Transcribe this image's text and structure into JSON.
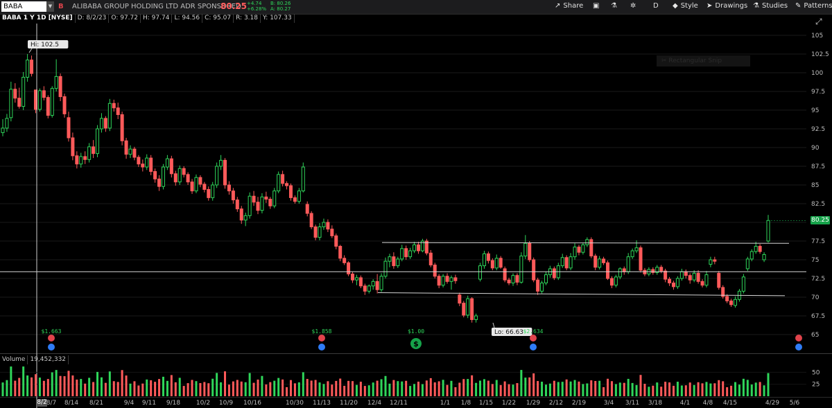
{
  "header": {
    "symbol": "BABA",
    "badge": "B",
    "company": "ALIBABA GROUP HOLDING LTD ADR SPONSORED",
    "last": "80.25",
    "change": "+4.74",
    "change_pct": "+6.28%",
    "bid": "B: 80.26",
    "ask": "A: 80.27",
    "share_label": "Share",
    "period_label": "D",
    "style_label": "Style",
    "drawings_label": "Drawings",
    "studies_label": "Studies",
    "patterns_label": "Patterns"
  },
  "info": {
    "title": "BABA 1 Y 1D [NYSE]",
    "date": "D: 8/2/23",
    "open": "O: 97.72",
    "high": "H: 97.74",
    "low": "L: 94.56",
    "close": "C: 95.07",
    "range": "R: 3.18",
    "y": "Y: 107.33"
  },
  "overlay": {
    "rect_snap": "Rectangular Snip",
    "hi_label": "Hi: 102.5",
    "lo_label": "Lo: 66.63",
    "price_tag": "80.25"
  },
  "volume": {
    "label": "Volume",
    "value": "19,452,332"
  },
  "colors": {
    "up": "#2fd65a",
    "down": "#ff5a5a",
    "grid": "#1a1a1a",
    "line": "#d8d8d8"
  },
  "chart_data": {
    "type": "candlestick",
    "y_ticks": [
      "105",
      "102.5",
      "100",
      "97.5",
      "95",
      "92.5",
      "90",
      "87.5",
      "85",
      "82.5",
      "80",
      "77.5",
      "75",
      "72.5",
      "70",
      "67.5",
      "65"
    ],
    "ylim": [
      63.2,
      107.33
    ],
    "x_ticks": [
      "8/2",
      "8/7",
      "8/14",
      "8/21",
      "9/4",
      "9/11",
      "9/18",
      "10/2",
      "10/9",
      "10/16",
      "10/30",
      "11/13",
      "11/20",
      "12/4",
      "12/11",
      "1/1",
      "1/8",
      "1/15",
      "1/22",
      "1/29",
      "2/12",
      "2/19",
      "3/4",
      "3/11",
      "3/18",
      "4/1",
      "4/8",
      "4/15",
      "4/29",
      "5/6"
    ],
    "volume_ticks": [
      "50",
      "25"
    ],
    "events": [
      {
        "label": "$1.663",
        "x_date": "8/7"
      },
      {
        "label": "$1.858",
        "x_date": "11/13"
      },
      {
        "label": "$1.00",
        "x_date": "12/18"
      },
      {
        "label": "$2.634",
        "x_date": "1/29"
      }
    ],
    "lines": [
      {
        "name": "horizontal",
        "y": 73.4
      },
      {
        "name": "channel-top",
        "y1": 77.3,
        "y2": 77.2
      },
      {
        "name": "channel-bottom",
        "y1": 70.6,
        "y2": 70.2
      }
    ],
    "series": [
      {
        "o": 92.0,
        "h": 93.8,
        "l": 91.5,
        "c": 92.6
      },
      {
        "o": 92.6,
        "h": 94.5,
        "l": 92.1,
        "c": 93.9
      },
      {
        "o": 94.0,
        "h": 98.8,
        "l": 93.5,
        "c": 97.8
      },
      {
        "o": 97.8,
        "h": 98.6,
        "l": 96.0,
        "c": 96.6
      },
      {
        "o": 96.6,
        "h": 98.0,
        "l": 95.2,
        "c": 95.5
      },
      {
        "o": 95.5,
        "h": 100.1,
        "l": 95.0,
        "c": 99.4
      },
      {
        "o": 99.4,
        "h": 102.5,
        "l": 98.8,
        "c": 101.7
      },
      {
        "o": 101.7,
        "h": 102.3,
        "l": 99.5,
        "c": 99.9
      },
      {
        "o": 97.7,
        "h": 97.7,
        "l": 94.6,
        "c": 95.1
      },
      {
        "o": 95.1,
        "h": 97.9,
        "l": 94.8,
        "c": 97.6
      },
      {
        "o": 97.6,
        "h": 98.2,
        "l": 96.3,
        "c": 96.7
      },
      {
        "o": 96.7,
        "h": 97.0,
        "l": 93.9,
        "c": 94.3
      },
      {
        "o": 94.3,
        "h": 98.2,
        "l": 94.0,
        "c": 97.9
      },
      {
        "o": 97.9,
        "h": 101.8,
        "l": 97.5,
        "c": 99.5
      },
      {
        "o": 99.5,
        "h": 99.9,
        "l": 96.2,
        "c": 96.8
      },
      {
        "o": 96.8,
        "h": 97.2,
        "l": 94.0,
        "c": 94.5
      },
      {
        "o": 94.0,
        "h": 94.8,
        "l": 90.8,
        "c": 91.3
      },
      {
        "o": 91.3,
        "h": 92.0,
        "l": 88.3,
        "c": 88.9
      },
      {
        "o": 88.9,
        "h": 89.5,
        "l": 87.2,
        "c": 87.8
      },
      {
        "o": 87.8,
        "h": 89.3,
        "l": 87.3,
        "c": 88.8
      },
      {
        "o": 88.8,
        "h": 89.5,
        "l": 87.8,
        "c": 88.4
      },
      {
        "o": 88.4,
        "h": 90.6,
        "l": 88.0,
        "c": 90.1
      },
      {
        "o": 90.1,
        "h": 91.0,
        "l": 88.6,
        "c": 89.2
      },
      {
        "o": 89.2,
        "h": 93.0,
        "l": 88.7,
        "c": 92.5
      },
      {
        "o": 92.5,
        "h": 94.6,
        "l": 92.0,
        "c": 93.9
      },
      {
        "o": 93.9,
        "h": 94.2,
        "l": 92.1,
        "c": 92.6
      },
      {
        "o": 92.6,
        "h": 96.5,
        "l": 92.2,
        "c": 95.9
      },
      {
        "o": 95.9,
        "h": 96.4,
        "l": 94.8,
        "c": 95.3
      },
      {
        "o": 95.3,
        "h": 96.0,
        "l": 93.8,
        "c": 94.4
      },
      {
        "o": 94.4,
        "h": 94.8,
        "l": 90.3,
        "c": 90.9
      },
      {
        "o": 90.9,
        "h": 91.3,
        "l": 88.5,
        "c": 89.1
      },
      {
        "o": 89.1,
        "h": 90.3,
        "l": 88.6,
        "c": 89.8
      },
      {
        "o": 89.8,
        "h": 90.1,
        "l": 88.3,
        "c": 88.7
      },
      {
        "o": 88.7,
        "h": 89.0,
        "l": 87.4,
        "c": 87.8
      },
      {
        "o": 87.8,
        "h": 88.4,
        "l": 86.8,
        "c": 87.4
      },
      {
        "o": 87.4,
        "h": 89.1,
        "l": 87.0,
        "c": 88.6
      },
      {
        "o": 88.6,
        "h": 89.0,
        "l": 86.3,
        "c": 86.8
      },
      {
        "o": 86.8,
        "h": 87.2,
        "l": 85.3,
        "c": 85.8
      },
      {
        "o": 85.8,
        "h": 86.3,
        "l": 84.2,
        "c": 84.8
      },
      {
        "o": 84.8,
        "h": 87.8,
        "l": 84.4,
        "c": 87.4
      },
      {
        "o": 87.4,
        "h": 89.0,
        "l": 87.0,
        "c": 88.5
      },
      {
        "o": 88.5,
        "h": 88.9,
        "l": 86.0,
        "c": 86.5
      },
      {
        "o": 86.5,
        "h": 86.9,
        "l": 84.9,
        "c": 85.4
      },
      {
        "o": 85.4,
        "h": 87.6,
        "l": 85.0,
        "c": 87.2
      },
      {
        "o": 87.2,
        "h": 87.5,
        "l": 86.0,
        "c": 86.4
      },
      {
        "o": 86.4,
        "h": 86.7,
        "l": 85.0,
        "c": 85.4
      },
      {
        "o": 85.4,
        "h": 85.8,
        "l": 83.8,
        "c": 84.2
      },
      {
        "o": 84.2,
        "h": 86.4,
        "l": 83.9,
        "c": 86.0
      },
      {
        "o": 86.0,
        "h": 86.3,
        "l": 84.7,
        "c": 85.1
      },
      {
        "o": 85.1,
        "h": 85.4,
        "l": 84.0,
        "c": 84.4
      },
      {
        "o": 84.4,
        "h": 84.8,
        "l": 82.9,
        "c": 83.3
      },
      {
        "o": 83.3,
        "h": 85.4,
        "l": 82.9,
        "c": 85.0
      },
      {
        "o": 85.0,
        "h": 88.0,
        "l": 84.6,
        "c": 87.5
      },
      {
        "o": 87.5,
        "h": 89.0,
        "l": 87.0,
        "c": 88.3
      },
      {
        "o": 88.3,
        "h": 88.6,
        "l": 84.5,
        "c": 85.0
      },
      {
        "o": 85.0,
        "h": 85.5,
        "l": 83.7,
        "c": 84.2
      },
      {
        "o": 84.2,
        "h": 84.6,
        "l": 82.5,
        "c": 83.0
      },
      {
        "o": 83.0,
        "h": 83.4,
        "l": 81.4,
        "c": 81.8
      },
      {
        "o": 81.8,
        "h": 82.2,
        "l": 79.8,
        "c": 80.3
      },
      {
        "o": 80.3,
        "h": 81.3,
        "l": 79.5,
        "c": 80.9
      },
      {
        "o": 80.9,
        "h": 84.0,
        "l": 80.5,
        "c": 83.5
      },
      {
        "o": 83.5,
        "h": 84.2,
        "l": 82.2,
        "c": 82.7
      },
      {
        "o": 82.7,
        "h": 83.4,
        "l": 81.1,
        "c": 81.6
      },
      {
        "o": 81.6,
        "h": 83.9,
        "l": 81.2,
        "c": 83.4
      },
      {
        "o": 83.4,
        "h": 84.1,
        "l": 82.6,
        "c": 83.1
      },
      {
        "o": 83.1,
        "h": 83.4,
        "l": 81.8,
        "c": 82.2
      },
      {
        "o": 82.2,
        "h": 84.6,
        "l": 81.9,
        "c": 84.2
      },
      {
        "o": 84.2,
        "h": 86.8,
        "l": 83.9,
        "c": 86.4
      },
      {
        "o": 86.4,
        "h": 86.9,
        "l": 84.8,
        "c": 85.2
      },
      {
        "o": 85.2,
        "h": 85.5,
        "l": 84.4,
        "c": 84.9
      },
      {
        "o": 84.9,
        "h": 85.2,
        "l": 82.9,
        "c": 83.3
      },
      {
        "o": 83.3,
        "h": 83.6,
        "l": 82.5,
        "c": 82.8
      },
      {
        "o": 82.8,
        "h": 84.6,
        "l": 82.5,
        "c": 84.2
      },
      {
        "o": 84.2,
        "h": 88.0,
        "l": 84.0,
        "c": 87.4
      },
      {
        "o": 82.4,
        "h": 82.8,
        "l": 80.8,
        "c": 81.2
      },
      {
        "o": 81.2,
        "h": 81.5,
        "l": 79.1,
        "c": 79.4
      },
      {
        "o": 79.4,
        "h": 79.7,
        "l": 77.6,
        "c": 78.0
      },
      {
        "o": 78.0,
        "h": 79.9,
        "l": 77.6,
        "c": 79.4
      },
      {
        "o": 79.4,
        "h": 80.5,
        "l": 79.0,
        "c": 80.0
      },
      {
        "o": 80.0,
        "h": 80.4,
        "l": 78.7,
        "c": 79.1
      },
      {
        "o": 79.1,
        "h": 79.6,
        "l": 77.9,
        "c": 78.2
      },
      {
        "o": 78.2,
        "h": 78.5,
        "l": 76.4,
        "c": 76.8
      },
      {
        "o": 76.8,
        "h": 77.0,
        "l": 74.8,
        "c": 75.2
      },
      {
        "o": 75.2,
        "h": 75.6,
        "l": 74.3,
        "c": 74.6
      },
      {
        "o": 74.6,
        "h": 74.8,
        "l": 72.8,
        "c": 73.1
      },
      {
        "o": 73.1,
        "h": 73.4,
        "l": 71.9,
        "c": 72.3
      },
      {
        "o": 72.3,
        "h": 73.0,
        "l": 71.6,
        "c": 72.6
      },
      {
        "o": 72.6,
        "h": 72.9,
        "l": 71.2,
        "c": 71.5
      },
      {
        "o": 71.5,
        "h": 71.8,
        "l": 70.3,
        "c": 70.8
      },
      {
        "o": 70.8,
        "h": 71.7,
        "l": 70.5,
        "c": 71.5
      },
      {
        "o": 71.5,
        "h": 72.4,
        "l": 71.0,
        "c": 72.1
      },
      {
        "o": 72.1,
        "h": 73.1,
        "l": 70.5,
        "c": 71.0
      },
      {
        "o": 71.0,
        "h": 73.2,
        "l": 70.7,
        "c": 72.8
      },
      {
        "o": 72.8,
        "h": 75.3,
        "l": 72.5,
        "c": 74.8
      },
      {
        "o": 74.8,
        "h": 75.8,
        "l": 74.0,
        "c": 75.4
      },
      {
        "o": 75.4,
        "h": 76.0,
        "l": 73.8,
        "c": 74.2
      },
      {
        "o": 74.2,
        "h": 75.4,
        "l": 73.9,
        "c": 75.1
      },
      {
        "o": 75.1,
        "h": 77.0,
        "l": 74.8,
        "c": 76.5
      },
      {
        "o": 76.5,
        "h": 76.9,
        "l": 75.0,
        "c": 75.4
      },
      {
        "o": 75.4,
        "h": 76.6,
        "l": 75.1,
        "c": 76.2
      },
      {
        "o": 76.2,
        "h": 77.4,
        "l": 75.9,
        "c": 77.0
      },
      {
        "o": 77.0,
        "h": 77.4,
        "l": 75.8,
        "c": 76.2
      },
      {
        "o": 76.2,
        "h": 77.8,
        "l": 76.0,
        "c": 77.5
      },
      {
        "o": 77.5,
        "h": 77.8,
        "l": 75.6,
        "c": 75.9
      },
      {
        "o": 75.9,
        "h": 76.3,
        "l": 74.0,
        "c": 74.3
      },
      {
        "o": 74.3,
        "h": 74.6,
        "l": 72.5,
        "c": 72.8
      },
      {
        "o": 72.8,
        "h": 73.1,
        "l": 71.2,
        "c": 71.6
      },
      {
        "o": 71.6,
        "h": 73.1,
        "l": 71.3,
        "c": 72.8
      },
      {
        "o": 72.8,
        "h": 73.2,
        "l": 71.8,
        "c": 72.1
      },
      {
        "o": 72.1,
        "h": 72.9,
        "l": 71.0,
        "c": 72.6
      },
      {
        "o": 72.6,
        "h": 73.0,
        "l": 71.8,
        "c": 72.2
      },
      {
        "o": 70.3,
        "h": 70.6,
        "l": 68.8,
        "c": 69.2
      },
      {
        "o": 69.2,
        "h": 69.5,
        "l": 67.3,
        "c": 67.6
      },
      {
        "o": 67.6,
        "h": 70.2,
        "l": 67.2,
        "c": 69.8
      },
      {
        "o": 69.8,
        "h": 70.0,
        "l": 66.6,
        "c": 67.0
      },
      {
        "o": 67.0,
        "h": 67.8,
        "l": 66.6,
        "c": 67.5
      },
      {
        "o": 72.4,
        "h": 74.6,
        "l": 72.1,
        "c": 74.2
      },
      {
        "o": 74.2,
        "h": 76.2,
        "l": 73.8,
        "c": 75.8
      },
      {
        "o": 75.8,
        "h": 76.1,
        "l": 74.5,
        "c": 74.9
      },
      {
        "o": 74.9,
        "h": 75.2,
        "l": 73.6,
        "c": 73.9
      },
      {
        "o": 73.9,
        "h": 75.7,
        "l": 73.6,
        "c": 75.2
      },
      {
        "o": 75.2,
        "h": 75.5,
        "l": 73.8,
        "c": 74.0
      },
      {
        "o": 73.8,
        "h": 74.1,
        "l": 72.0,
        "c": 72.3
      },
      {
        "o": 72.3,
        "h": 72.6,
        "l": 71.6,
        "c": 71.9
      },
      {
        "o": 71.9,
        "h": 73.2,
        "l": 71.5,
        "c": 72.9
      },
      {
        "o": 72.9,
        "h": 73.2,
        "l": 71.6,
        "c": 72.0
      },
      {
        "o": 72.0,
        "h": 76.0,
        "l": 71.8,
        "c": 75.5
      },
      {
        "o": 75.5,
        "h": 78.3,
        "l": 75.1,
        "c": 77.2
      },
      {
        "o": 77.2,
        "h": 77.5,
        "l": 74.7,
        "c": 75.0
      },
      {
        "o": 75.0,
        "h": 75.3,
        "l": 72.0,
        "c": 72.3
      },
      {
        "o": 72.3,
        "h": 72.6,
        "l": 70.3,
        "c": 70.8
      },
      {
        "o": 70.8,
        "h": 72.2,
        "l": 70.5,
        "c": 71.9
      },
      {
        "o": 71.9,
        "h": 73.4,
        "l": 71.6,
        "c": 73.0
      },
      {
        "o": 73.0,
        "h": 74.2,
        "l": 72.6,
        "c": 73.8
      },
      {
        "o": 73.8,
        "h": 74.1,
        "l": 72.3,
        "c": 72.6
      },
      {
        "o": 72.6,
        "h": 74.6,
        "l": 72.3,
        "c": 74.2
      },
      {
        "o": 74.2,
        "h": 75.8,
        "l": 73.9,
        "c": 75.3
      },
      {
        "o": 75.3,
        "h": 75.6,
        "l": 73.6,
        "c": 73.9
      },
      {
        "o": 73.9,
        "h": 75.9,
        "l": 73.6,
        "c": 75.4
      },
      {
        "o": 75.4,
        "h": 77.2,
        "l": 75.0,
        "c": 76.7
      },
      {
        "o": 76.7,
        "h": 77.0,
        "l": 75.6,
        "c": 76.0
      },
      {
        "o": 76.0,
        "h": 77.3,
        "l": 75.7,
        "c": 77.0
      },
      {
        "o": 77.0,
        "h": 78.0,
        "l": 76.7,
        "c": 77.7
      },
      {
        "o": 77.7,
        "h": 78.0,
        "l": 75.2,
        "c": 75.5
      },
      {
        "o": 75.5,
        "h": 75.8,
        "l": 73.6,
        "c": 74.0
      },
      {
        "o": 74.0,
        "h": 75.5,
        "l": 73.7,
        "c": 75.1
      },
      {
        "o": 75.1,
        "h": 75.4,
        "l": 74.3,
        "c": 74.6
      },
      {
        "o": 74.6,
        "h": 74.9,
        "l": 72.3,
        "c": 72.5
      },
      {
        "o": 72.5,
        "h": 72.8,
        "l": 71.2,
        "c": 71.6
      },
      {
        "o": 71.6,
        "h": 73.0,
        "l": 71.3,
        "c": 72.7
      },
      {
        "o": 72.7,
        "h": 74.0,
        "l": 72.4,
        "c": 73.8
      },
      {
        "o": 73.8,
        "h": 74.1,
        "l": 73.0,
        "c": 73.4
      },
      {
        "o": 73.4,
        "h": 75.9,
        "l": 73.1,
        "c": 75.4
      },
      {
        "o": 75.4,
        "h": 76.5,
        "l": 75.1,
        "c": 76.2
      },
      {
        "o": 76.2,
        "h": 77.6,
        "l": 75.9,
        "c": 76.6
      },
      {
        "o": 76.6,
        "h": 76.9,
        "l": 73.3,
        "c": 73.6
      },
      {
        "o": 73.6,
        "h": 73.9,
        "l": 72.8,
        "c": 73.1
      },
      {
        "o": 73.1,
        "h": 74.0,
        "l": 72.8,
        "c": 73.7
      },
      {
        "o": 73.7,
        "h": 74.0,
        "l": 73.0,
        "c": 73.3
      },
      {
        "o": 73.3,
        "h": 74.3,
        "l": 73.0,
        "c": 74.0
      },
      {
        "o": 74.0,
        "h": 74.3,
        "l": 73.2,
        "c": 73.5
      },
      {
        "o": 73.5,
        "h": 73.8,
        "l": 72.0,
        "c": 72.4
      },
      {
        "o": 72.4,
        "h": 72.7,
        "l": 71.5,
        "c": 71.9
      },
      {
        "o": 71.9,
        "h": 72.2,
        "l": 71.0,
        "c": 71.4
      },
      {
        "o": 71.4,
        "h": 72.8,
        "l": 71.1,
        "c": 72.5
      },
      {
        "o": 72.5,
        "h": 73.8,
        "l": 72.2,
        "c": 73.4
      },
      {
        "o": 73.4,
        "h": 73.7,
        "l": 72.5,
        "c": 72.9
      },
      {
        "o": 72.9,
        "h": 73.2,
        "l": 71.8,
        "c": 72.3
      },
      {
        "o": 72.3,
        "h": 73.6,
        "l": 72.0,
        "c": 73.2
      },
      {
        "o": 73.2,
        "h": 73.6,
        "l": 71.8,
        "c": 72.1
      },
      {
        "o": 72.1,
        "h": 72.4,
        "l": 71.3,
        "c": 71.6
      },
      {
        "o": 71.6,
        "h": 73.5,
        "l": 71.3,
        "c": 73.0
      },
      {
        "o": 74.4,
        "h": 75.4,
        "l": 74.0,
        "c": 75.0
      },
      {
        "o": 75.0,
        "h": 75.4,
        "l": 74.4,
        "c": 74.8
      },
      {
        "o": 73.2,
        "h": 73.5,
        "l": 71.0,
        "c": 71.3
      },
      {
        "o": 71.3,
        "h": 71.6,
        "l": 69.8,
        "c": 70.1
      },
      {
        "o": 70.1,
        "h": 70.4,
        "l": 69.2,
        "c": 69.5
      },
      {
        "o": 69.5,
        "h": 69.8,
        "l": 68.7,
        "c": 69.0
      },
      {
        "o": 68.9,
        "h": 70.1,
        "l": 68.6,
        "c": 69.7
      },
      {
        "o": 69.7,
        "h": 71.1,
        "l": 69.4,
        "c": 70.8
      },
      {
        "o": 70.8,
        "h": 73.1,
        "l": 70.5,
        "c": 72.7
      },
      {
        "o": 73.8,
        "h": 75.4,
        "l": 73.5,
        "c": 75.1
      },
      {
        "o": 75.1,
        "h": 76.4,
        "l": 74.8,
        "c": 76.1
      },
      {
        "o": 76.1,
        "h": 77.4,
        "l": 75.8,
        "c": 76.8
      },
      {
        "o": 76.8,
        "h": 77.1,
        "l": 75.8,
        "c": 76.1
      },
      {
        "o": 75.0,
        "h": 76.0,
        "l": 74.7,
        "c": 75.7
      },
      {
        "o": 77.5,
        "h": 81.0,
        "l": 77.3,
        "c": 80.25
      }
    ]
  }
}
